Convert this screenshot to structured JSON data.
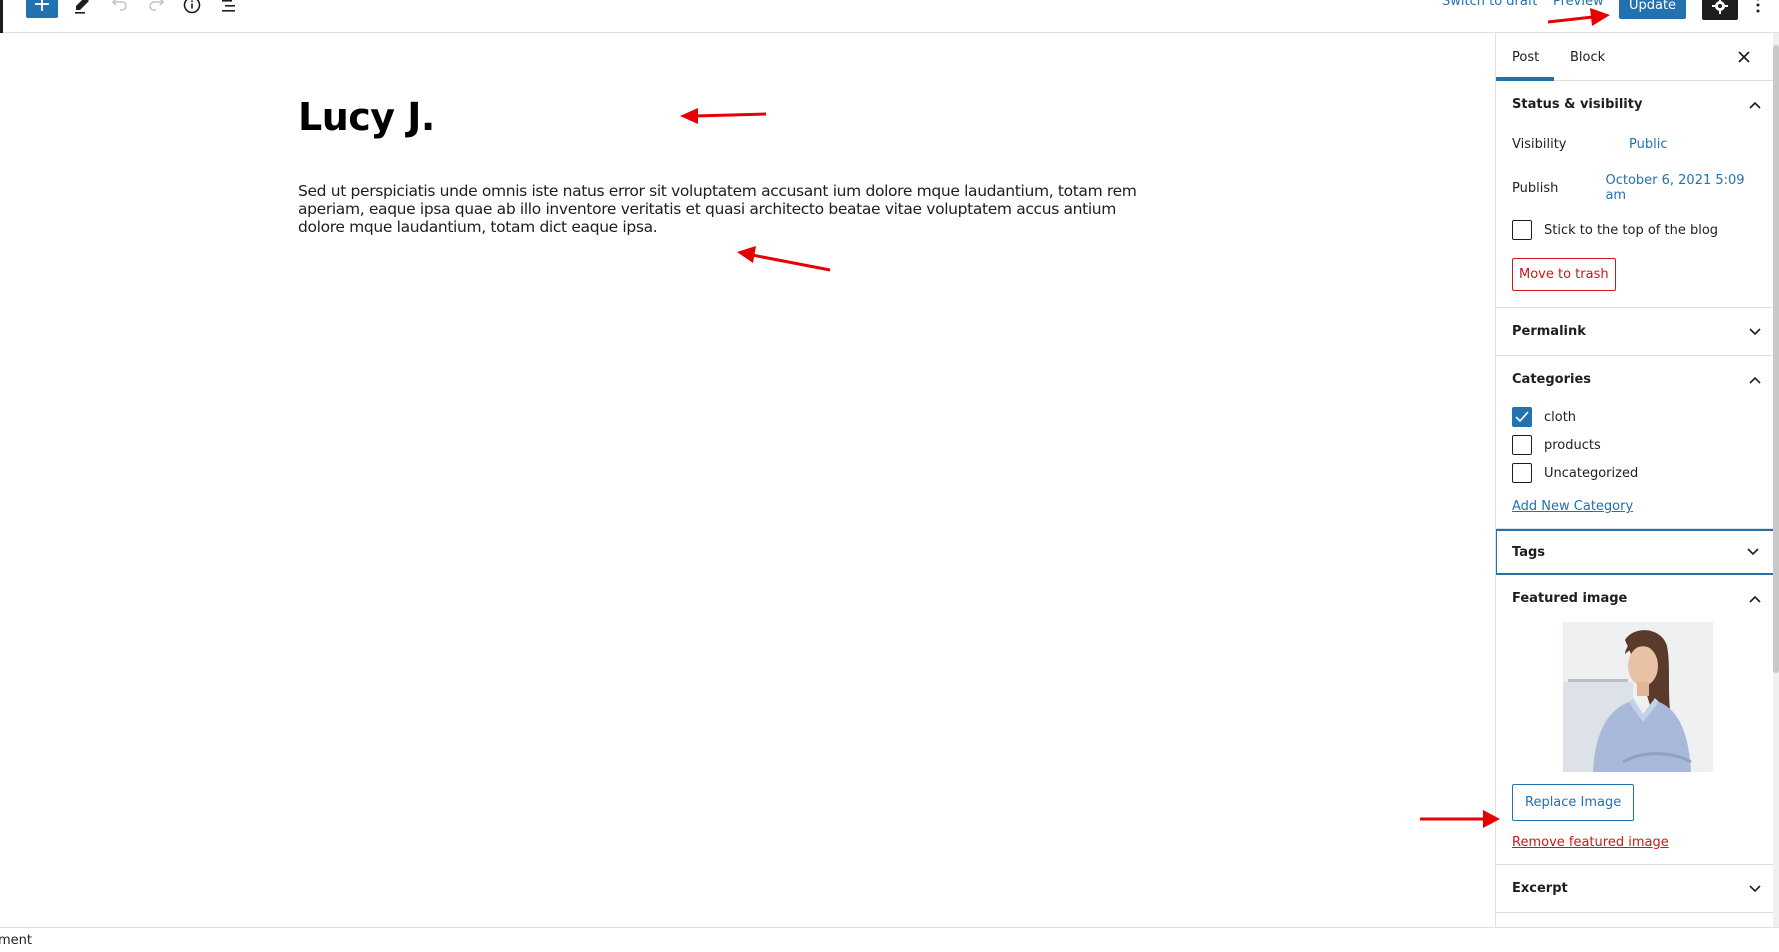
{
  "header": {
    "add_block_label": "+",
    "tools_icon": "pencil-icon",
    "undo_icon": "undo-icon",
    "redo_icon": "redo-icon",
    "details_icon": "info-icon",
    "outline_icon": "list-view-icon",
    "switch_to_draft": "Switch to draft",
    "preview": "Preview",
    "update": "Update",
    "settings_icon": "gear-icon",
    "more_icon": "vertical-ellipsis-icon"
  },
  "editor": {
    "title": "Lucy J.",
    "paragraph": "Sed ut perspiciatis unde omnis iste natus error sit voluptatem accusant ium dolore mque laudantium, totam rem aperiam, eaque ipsa quae ab illo inventore veritatis et quasi architecto beatae vitae voluptatem accus antium dolore mque laudantium, totam dict eaque ipsa."
  },
  "sidebar": {
    "tabs": [
      {
        "label": "Post",
        "active": true
      },
      {
        "label": "Block",
        "active": false
      }
    ],
    "close_icon": "close-icon",
    "status": {
      "title": "Status & visibility",
      "expanded": true,
      "visibility_label": "Visibility",
      "visibility_value": "Public",
      "publish_label": "Publish",
      "publish_value": "October 6, 2021 5:09 am",
      "sticky_label": "Stick to the top of the blog",
      "sticky_checked": false,
      "trash_label": "Move to trash"
    },
    "permalink": {
      "title": "Permalink",
      "expanded": false
    },
    "categories": {
      "title": "Categories",
      "expanded": true,
      "items": [
        {
          "label": "cloth",
          "checked": true
        },
        {
          "label": "products",
          "checked": false
        },
        {
          "label": "Uncategorized",
          "checked": false
        }
      ],
      "add_new_label": "Add New Category"
    },
    "tags": {
      "title": "Tags",
      "expanded": false
    },
    "featured_image": {
      "title": "Featured image",
      "expanded": true,
      "image_alt": "Woman in light blue shirt smiling",
      "replace_label": "Replace Image",
      "remove_label": "Remove featured image"
    },
    "excerpt": {
      "title": "Excerpt",
      "expanded": false
    }
  },
  "footer": {
    "breadcrumb": "ment"
  },
  "colors": {
    "accent": "#2271b1",
    "destructive": "#cc1818",
    "annotation": "#e60000"
  }
}
